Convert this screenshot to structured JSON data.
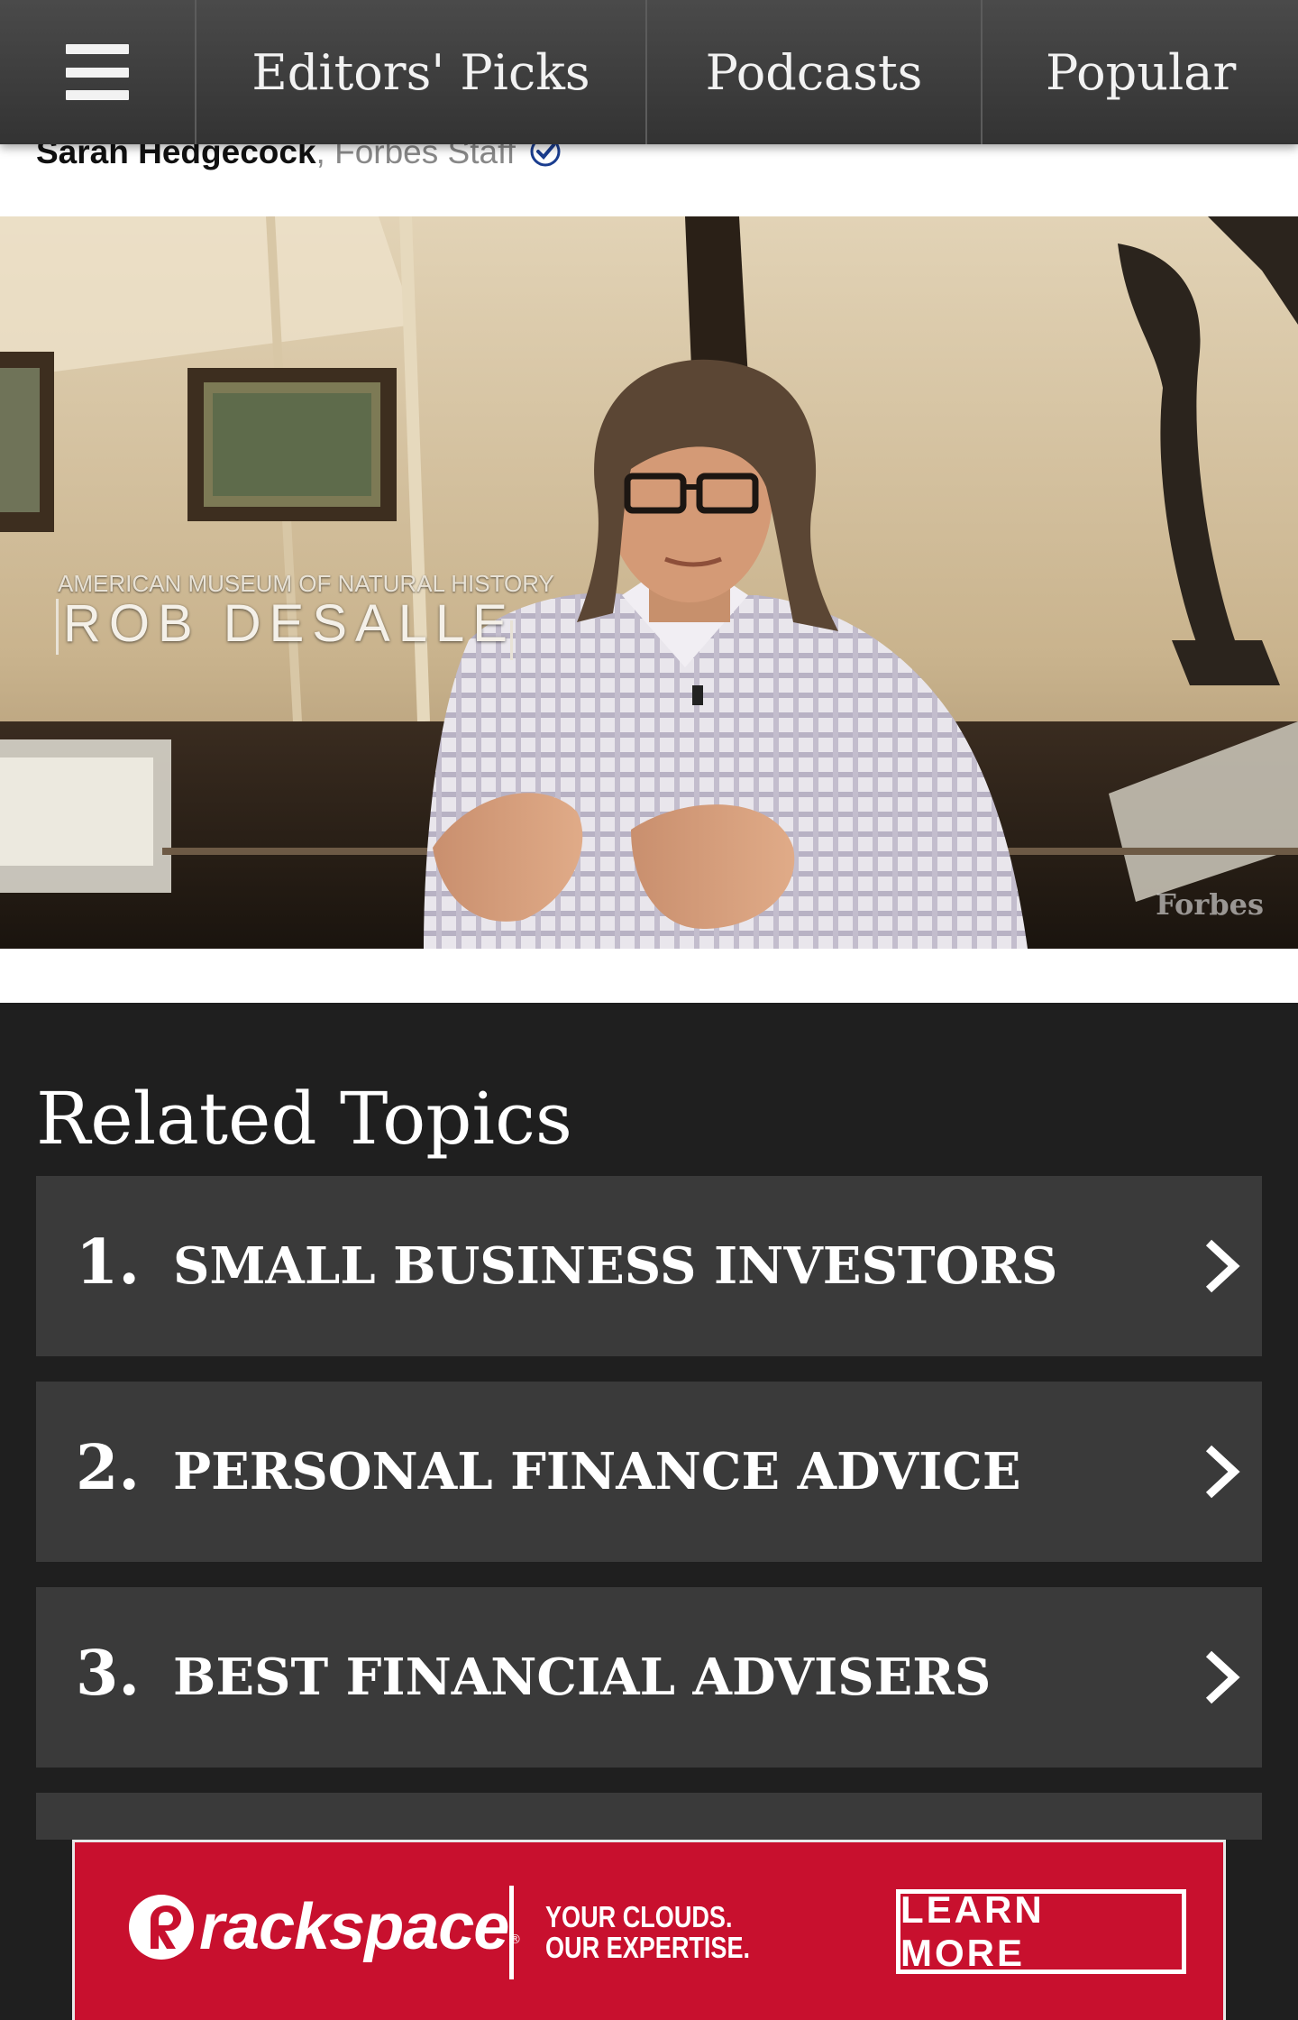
{
  "nav": {
    "menu_icon": "hamburger-menu-icon",
    "tabs": [
      {
        "label": "Editors' Picks"
      },
      {
        "label": "Podcasts"
      },
      {
        "label": "Popular"
      }
    ]
  },
  "byline": {
    "author": "Sarah Hedgecock",
    "separator": ", ",
    "role": "Forbes Staff",
    "verified_icon": "verified-check-icon"
  },
  "video": {
    "lower_third_org": "AMERICAN MUSEUM OF NATURAL HISTORY",
    "lower_third_name": "ROB DESALLE",
    "watermark": "Forbes"
  },
  "related_topics": {
    "title": "Related Topics",
    "items": [
      {
        "number": "1.",
        "label": "SMALL BUSINESS INVESTORS"
      },
      {
        "number": "2.",
        "label": "PERSONAL FINANCE ADVICE"
      },
      {
        "number": "3.",
        "label": "BEST FINANCIAL ADVISERS"
      }
    ],
    "chevron_icon": "chevron-right-icon"
  },
  "ad": {
    "brand": "rackspace",
    "registered_mark": "®",
    "tagline_line1": "YOUR CLOUDS.",
    "tagline_line2": "OUR EXPERTISE.",
    "cta": "LEARN MORE",
    "colors": {
      "background": "#c8102e",
      "text": "#ffffff"
    }
  },
  "colors": {
    "nav_background": "#3d3d3d",
    "section_background": "#1f1f1f",
    "topic_background": "#3a3a3a"
  }
}
